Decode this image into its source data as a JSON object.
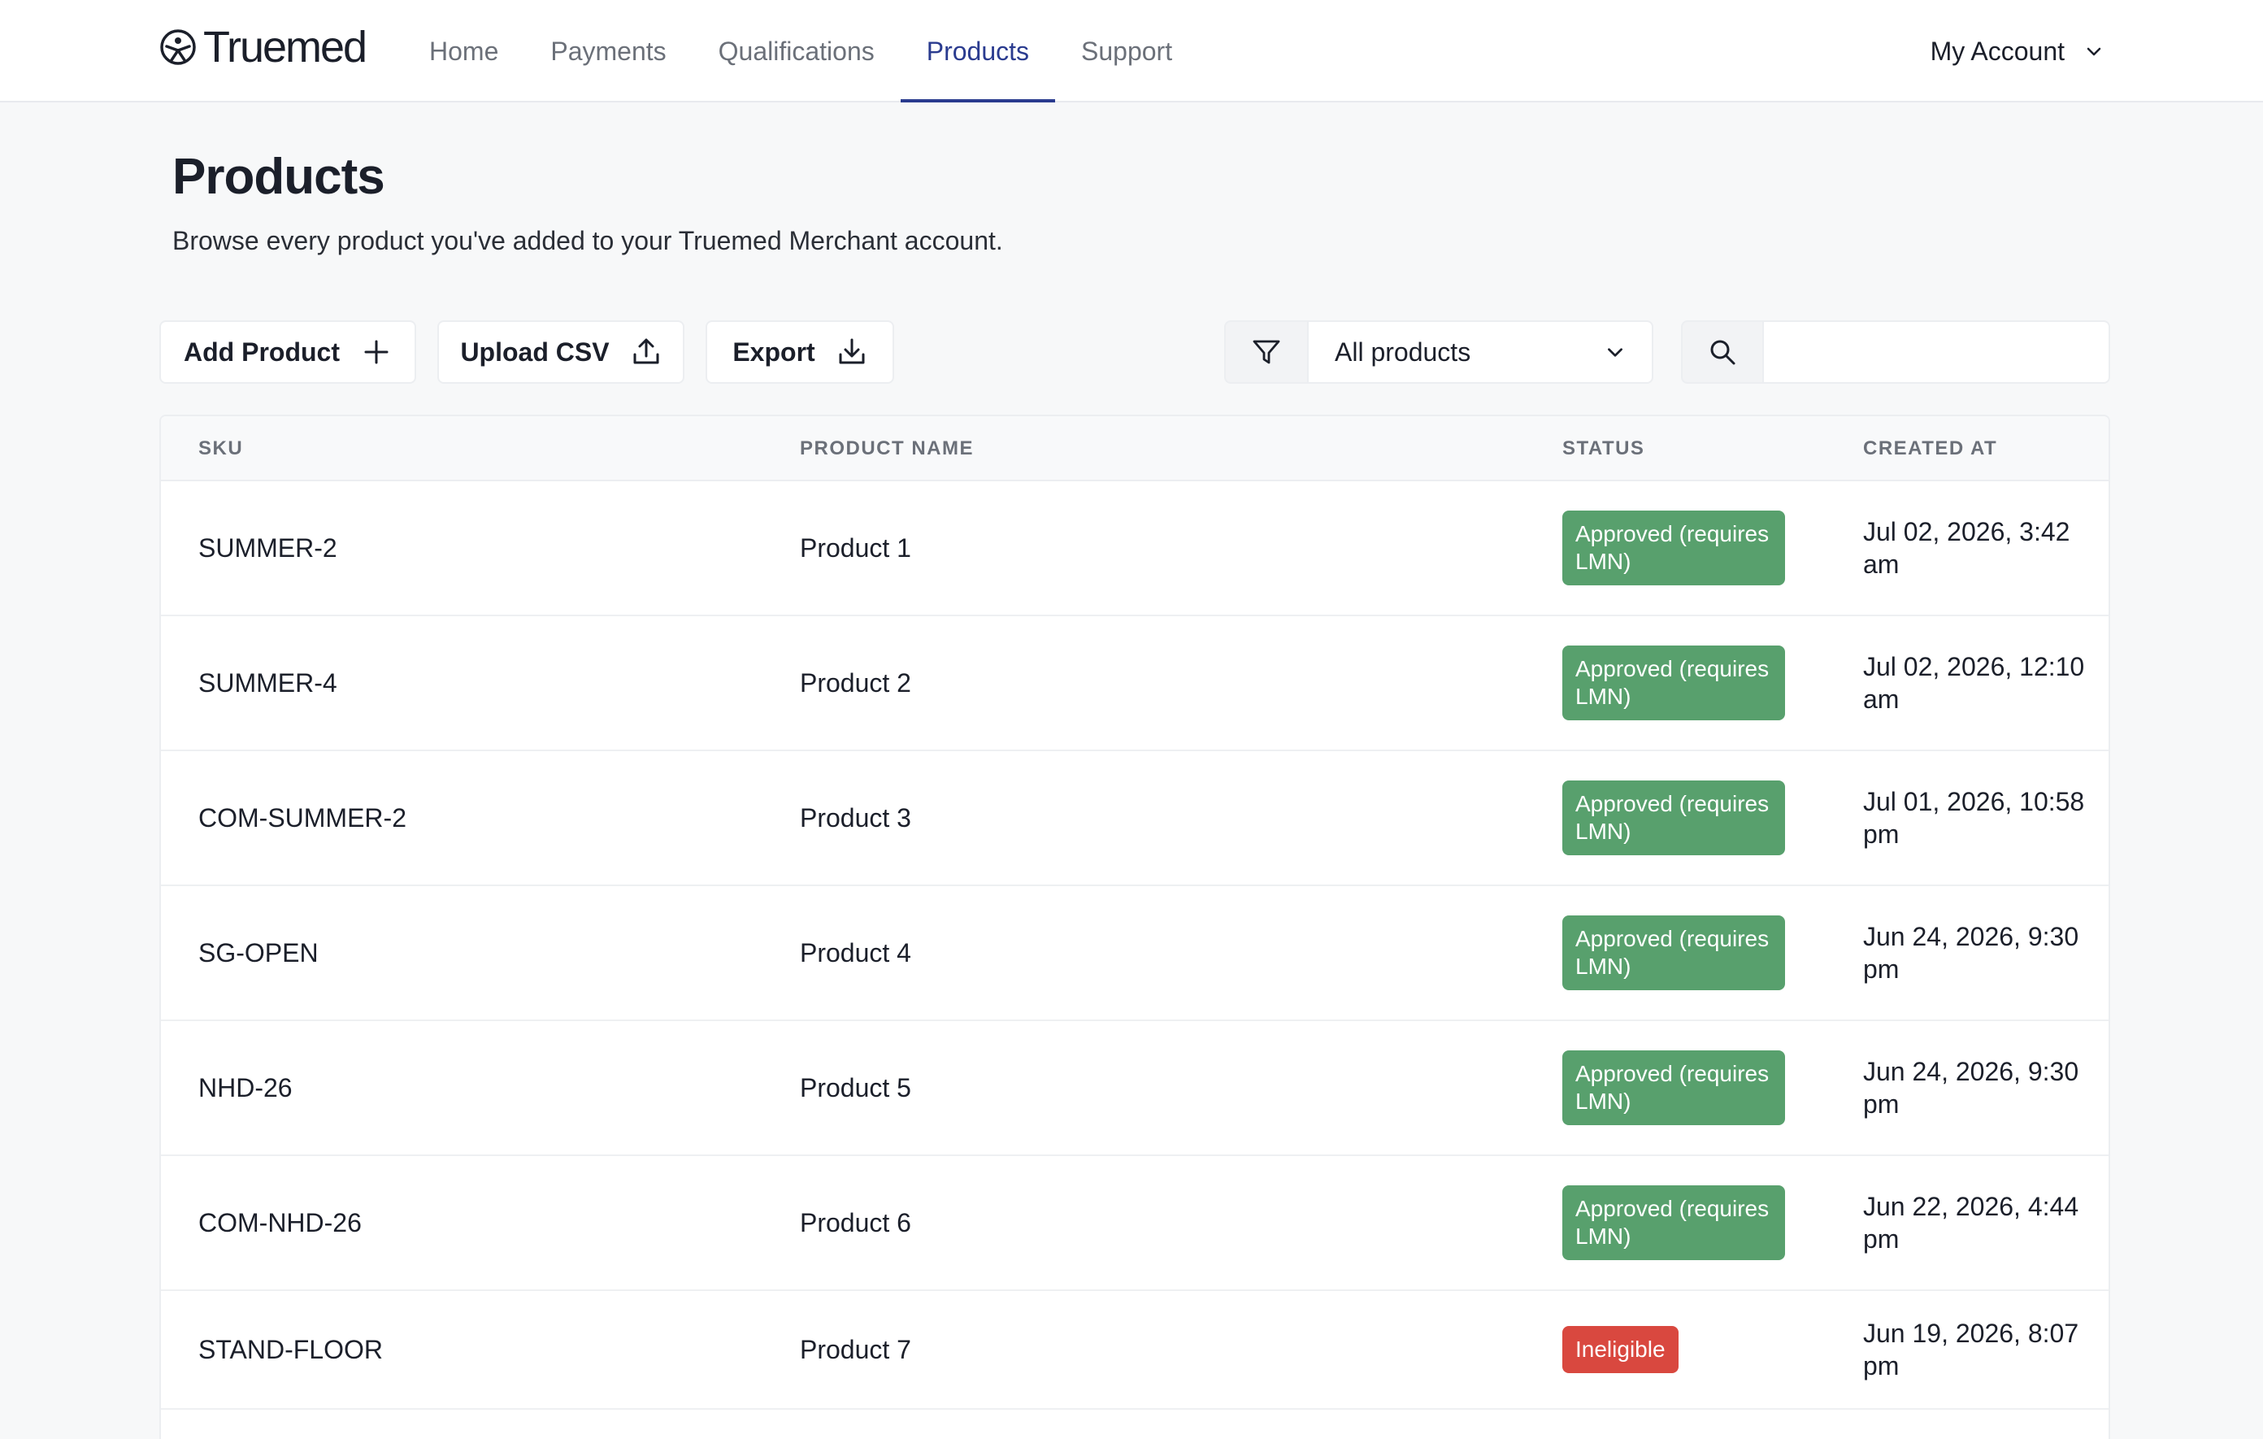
{
  "brand": {
    "name": "Truemed"
  },
  "nav": {
    "items": [
      {
        "label": "Home"
      },
      {
        "label": "Payments"
      },
      {
        "label": "Qualifications"
      },
      {
        "label": "Products",
        "active": true
      },
      {
        "label": "Support"
      }
    ],
    "account_label": "My Account"
  },
  "page": {
    "title": "Products",
    "subtitle": "Browse every product you've added to your Truemed Merchant account."
  },
  "toolbar": {
    "add_label": "Add Product",
    "upload_label": "Upload CSV",
    "export_label": "Export",
    "filter_value": "All products",
    "search_value": ""
  },
  "table": {
    "columns": [
      "SKU",
      "PRODUCT NAME",
      "STATUS",
      "CREATED AT"
    ],
    "rows": [
      {
        "sku": "SUMMER-2",
        "name": "Product 1",
        "status": "Approved (requires LMN)",
        "status_kind": "approved",
        "created": "Jul 02, 2026, 3:42 am"
      },
      {
        "sku": "SUMMER-4",
        "name": "Product 2",
        "status": "Approved (requires LMN)",
        "status_kind": "approved",
        "created": "Jul 02, 2026, 12:10 am"
      },
      {
        "sku": "COM-SUMMER-2",
        "name": "Product 3",
        "status": "Approved (requires LMN)",
        "status_kind": "approved",
        "created": "Jul 01, 2026, 10:58 pm"
      },
      {
        "sku": "SG-OPEN",
        "name": "Product 4",
        "status": "Approved (requires LMN)",
        "status_kind": "approved",
        "created": "Jun 24, 2026, 9:30 pm"
      },
      {
        "sku": "NHD-26",
        "name": "Product 5",
        "status": "Approved (requires LMN)",
        "status_kind": "approved",
        "created": "Jun 24, 2026, 9:30 pm"
      },
      {
        "sku": "COM-NHD-26",
        "name": "Product 6",
        "status": "Approved (requires LMN)",
        "status_kind": "approved",
        "created": "Jun 22, 2026, 4:44 pm"
      },
      {
        "sku": "STAND-FLOOR",
        "name": "Product 7",
        "status": "Ineligible",
        "status_kind": "ineligible",
        "created": "Jun 19, 2026, 8:07 pm"
      }
    ]
  },
  "colors": {
    "accent": "#2a3b8f",
    "approved": "#58a06d",
    "ineligible": "#d9483f"
  }
}
